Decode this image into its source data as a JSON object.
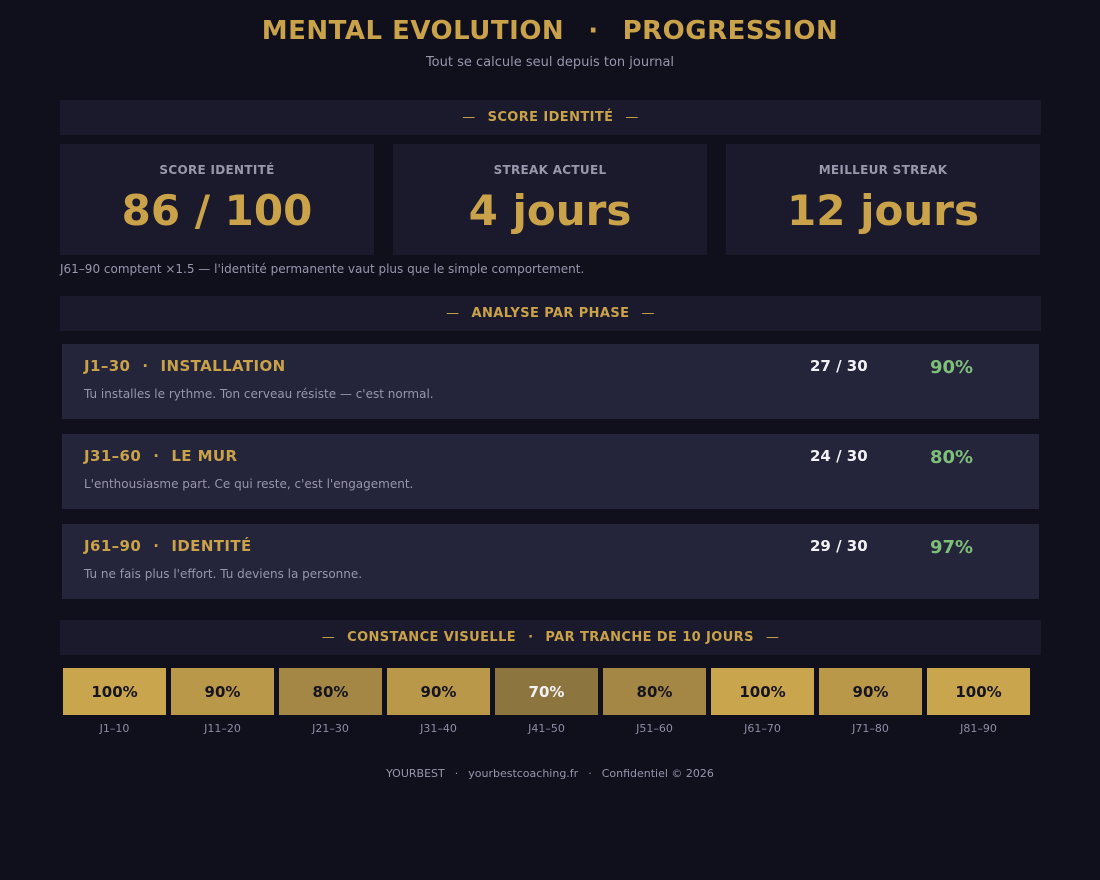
{
  "header": {
    "title_left": "MENTAL EVOLUTION",
    "title_sep": "·",
    "title_right": "PROGRESSION",
    "subtitle": "Tout se calcule seul depuis ton journal"
  },
  "sections": {
    "dash": "—",
    "score": "SCORE IDENTITÉ",
    "phase": "ANALYSE PAR PHASE",
    "constance_left": "CONSTANCE VISUELLE",
    "constance_sep": "·",
    "constance_right": "PAR TRANCHE DE 10 JOURS"
  },
  "stats": [
    {
      "label": "SCORE IDENTITÉ",
      "value": "86 / 100"
    },
    {
      "label": "STREAK ACTUEL",
      "value": "4 jours"
    },
    {
      "label": "MEILLEUR STREAK",
      "value": "12 jours"
    }
  ],
  "note": "J61–90 comptent ×1.5 — l'identité permanente vaut plus que le simple comportement.",
  "phases": [
    {
      "range": "J1–30",
      "sep": "·",
      "name": "INSTALLATION",
      "desc": "Tu installes le rythme. Ton cerveau résiste — c'est normal.",
      "score": "27 / 30",
      "pct": "90%"
    },
    {
      "range": "J31–60",
      "sep": "·",
      "name": "LE MUR",
      "desc": "L'enthousiasme part. Ce qui reste, c'est l'engagement.",
      "score": "24 / 30",
      "pct": "80%"
    },
    {
      "range": "J61–90",
      "sep": "·",
      "name": "IDENTITÉ",
      "desc": "Tu ne fais plus l'effort. Tu deviens la personne.",
      "score": "29 / 30",
      "pct": "97%"
    }
  ],
  "constance": [
    {
      "label": "J1–10",
      "pct": "100%",
      "value": 100
    },
    {
      "label": "J11–20",
      "pct": "90%",
      "value": 90
    },
    {
      "label": "J21–30",
      "pct": "80%",
      "value": 80
    },
    {
      "label": "J31–40",
      "pct": "90%",
      "value": 90
    },
    {
      "label": "J41–50",
      "pct": "70%",
      "value": 70
    },
    {
      "label": "J51–60",
      "pct": "80%",
      "value": 80
    },
    {
      "label": "J61–70",
      "pct": "100%",
      "value": 100
    },
    {
      "label": "J71–80",
      "pct": "90%",
      "value": 90
    },
    {
      "label": "J81–90",
      "pct": "100%",
      "value": 100
    }
  ],
  "colors": {
    "accent": "#c9a24a",
    "success": "#7fbf7a",
    "bg": "#100f1c",
    "panel": "#1a1a2c",
    "card": "#24243a",
    "heat_100": "#c9a54d",
    "heat_90": "#b99849",
    "heat_80": "#a48745",
    "heat_70": "#8d7540"
  },
  "footer": {
    "brand": "YOURBEST",
    "sep": "·",
    "site": "yourbestcoaching.fr",
    "copyright": "Confidentiel © 2026"
  }
}
